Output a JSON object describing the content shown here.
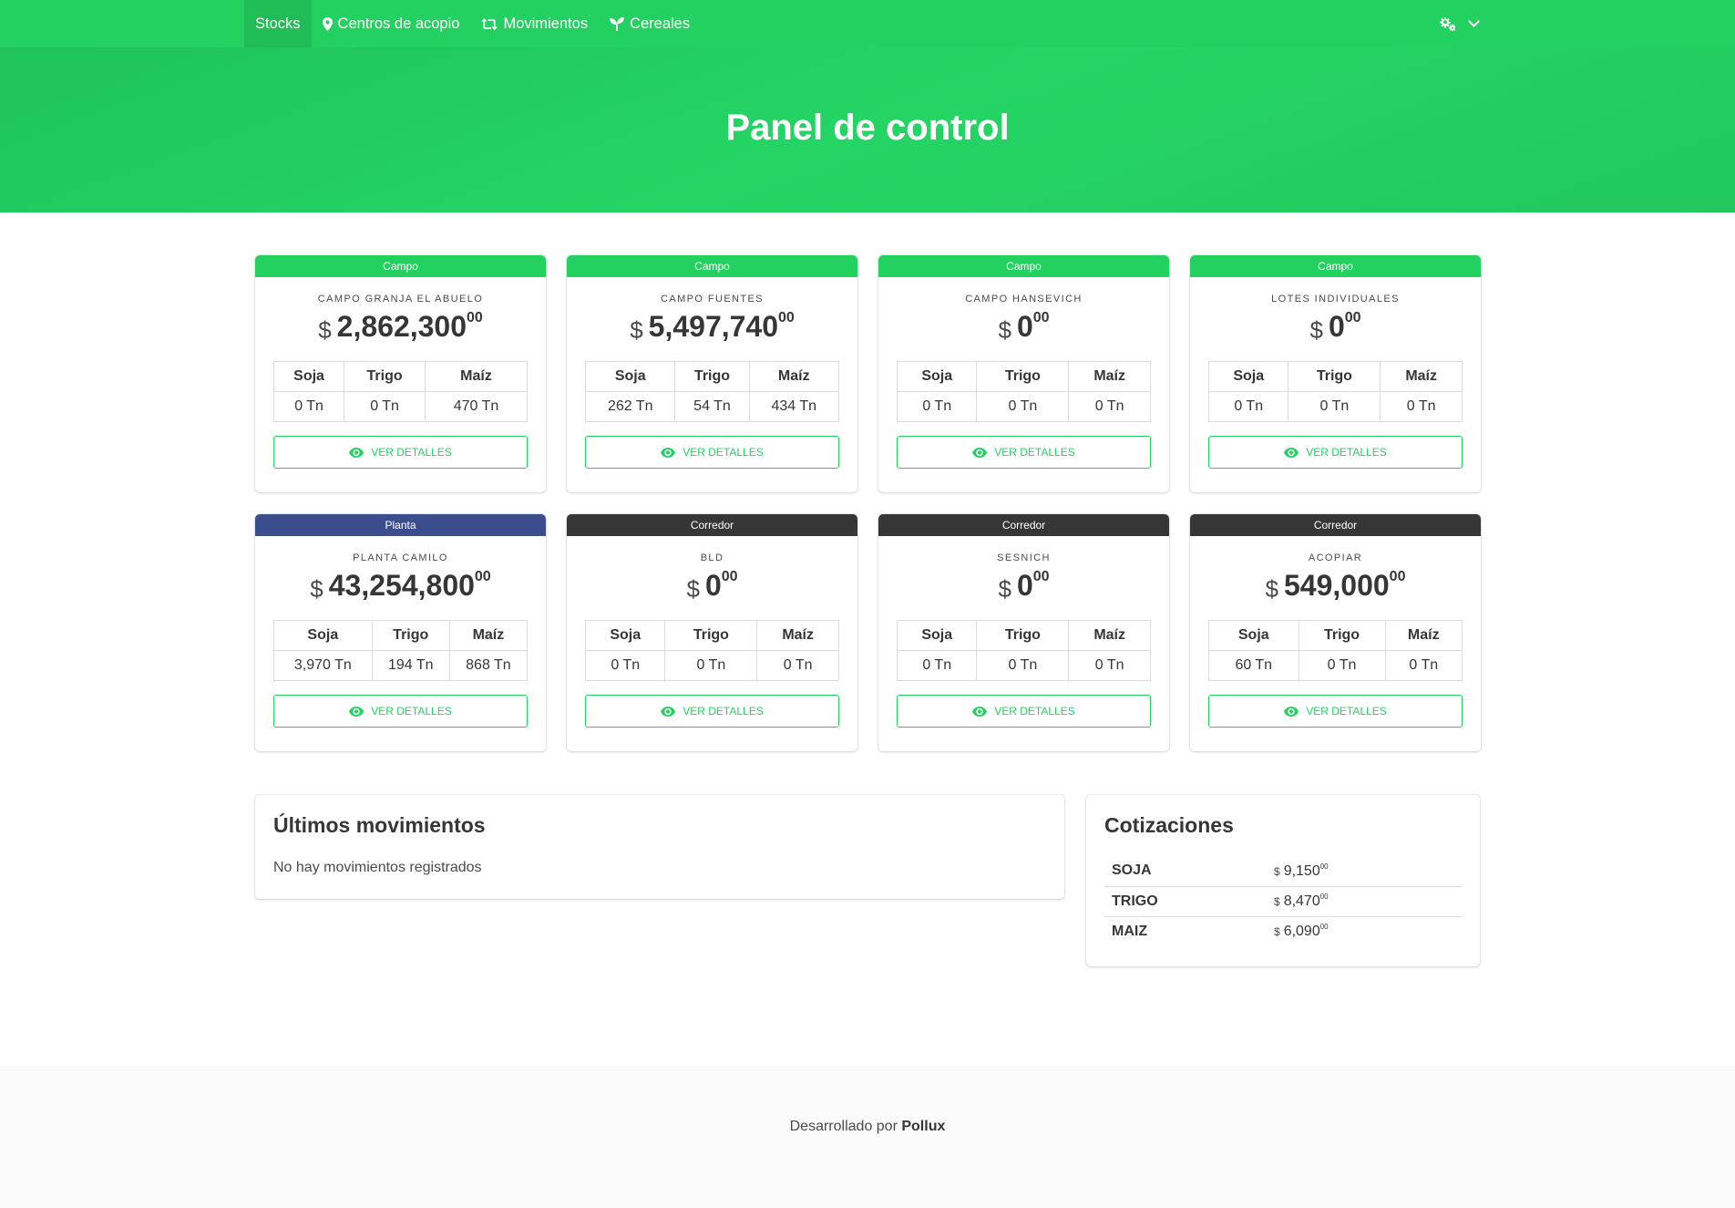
{
  "nav": {
    "items": [
      {
        "label": "Stocks",
        "icon": "none",
        "active": true
      },
      {
        "label": "Centros de acopio",
        "icon": "map-marker-icon"
      },
      {
        "label": "Movimientos",
        "icon": "retweet-icon"
      },
      {
        "label": "Cereales",
        "icon": "seedling-icon"
      }
    ],
    "settings_icon": "cogs-icon",
    "dropdown_icon": "chevron-down-icon"
  },
  "hero": {
    "title": "Panel de control"
  },
  "cards": [
    {
      "tag": "Campo",
      "tag_color": "#23d160",
      "name": "CAMPO GRANJA EL ABUELO",
      "currency": "$",
      "amount": "2,862,300",
      "decimals": "00",
      "headers": [
        "Soja",
        "Trigo",
        "Maíz"
      ],
      "values": [
        "0 Tn",
        "0 Tn",
        "470 Tn"
      ],
      "button": "VER DETALLES"
    },
    {
      "tag": "Campo",
      "tag_color": "#23d160",
      "name": "CAMPO FUENTES",
      "currency": "$",
      "amount": "5,497,740",
      "decimals": "00",
      "headers": [
        "Soja",
        "Trigo",
        "Maíz"
      ],
      "values": [
        "262 Tn",
        "54 Tn",
        "434 Tn"
      ],
      "button": "VER DETALLES"
    },
    {
      "tag": "Campo",
      "tag_color": "#23d160",
      "name": "CAMPO HANSEVICH",
      "currency": "$",
      "amount": "0",
      "decimals": "00",
      "headers": [
        "Soja",
        "Trigo",
        "Maíz"
      ],
      "values": [
        "0 Tn",
        "0 Tn",
        "0 Tn"
      ],
      "button": "VER DETALLES"
    },
    {
      "tag": "Campo",
      "tag_color": "#23d160",
      "name": "LOTES INDIVIDUALES",
      "currency": "$",
      "amount": "0",
      "decimals": "00",
      "headers": [
        "Soja",
        "Trigo",
        "Maíz"
      ],
      "values": [
        "0 Tn",
        "0 Tn",
        "0 Tn"
      ],
      "button": "VER DETALLES"
    },
    {
      "tag": "Planta",
      "tag_color": "#3b4d8c",
      "name": "PLANTA CAMILO",
      "currency": "$",
      "amount": "43,254,800",
      "decimals": "00",
      "headers": [
        "Soja",
        "Trigo",
        "Maíz"
      ],
      "values": [
        "3,970 Tn",
        "194 Tn",
        "868 Tn"
      ],
      "button": "VER DETALLES"
    },
    {
      "tag": "Corredor",
      "tag_color": "#363636",
      "name": "BLD",
      "currency": "$",
      "amount": "0",
      "decimals": "00",
      "headers": [
        "Soja",
        "Trigo",
        "Maíz"
      ],
      "values": [
        "0 Tn",
        "0 Tn",
        "0 Tn"
      ],
      "button": "VER DETALLES"
    },
    {
      "tag": "Corredor",
      "tag_color": "#363636",
      "name": "SESNICH",
      "currency": "$",
      "amount": "0",
      "decimals": "00",
      "headers": [
        "Soja",
        "Trigo",
        "Maíz"
      ],
      "values": [
        "0 Tn",
        "0 Tn",
        "0 Tn"
      ],
      "button": "VER DETALLES"
    },
    {
      "tag": "Corredor",
      "tag_color": "#363636",
      "name": "ACOPIAR",
      "currency": "$",
      "amount": "549,000",
      "decimals": "00",
      "headers": [
        "Soja",
        "Trigo",
        "Maíz"
      ],
      "values": [
        "60 Tn",
        "0 Tn",
        "0 Tn"
      ],
      "button": "VER DETALLES"
    }
  ],
  "movimientos": {
    "title": "Últimos movimientos",
    "empty": "No hay movimientos registrados"
  },
  "cotizaciones": {
    "title": "Cotizaciones",
    "rows": [
      {
        "name": "SOJA",
        "currency": "$",
        "value": "9,150",
        "decimals": "00"
      },
      {
        "name": "TRIGO",
        "currency": "$",
        "value": "8,470",
        "decimals": "00"
      },
      {
        "name": "MAIZ",
        "currency": "$",
        "value": "6,090",
        "decimals": "00"
      }
    ]
  },
  "footer": {
    "prefix": "Desarrollado por",
    "brand": "Pollux"
  },
  "colors": {
    "primary": "#23d160",
    "planta": "#3b4d8c",
    "corredor": "#363636"
  }
}
